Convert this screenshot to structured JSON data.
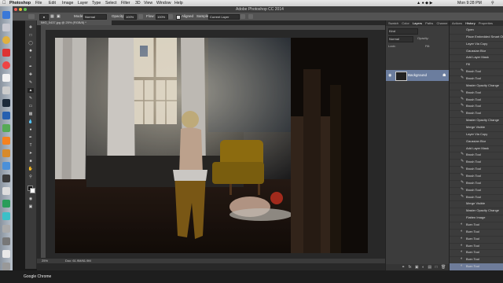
{
  "menubar": {
    "app": "Photoshop",
    "items": [
      "File",
      "Edit",
      "Image",
      "Layer",
      "Type",
      "Select",
      "Filter",
      "3D",
      "View",
      "Window",
      "Help"
    ],
    "clock": "Mon 9:28 PM"
  },
  "window": {
    "title": "Adobe Photoshop CC 2014"
  },
  "options": {
    "mode_label": "Mode:",
    "mode_value": "Normal",
    "opacity_label": "Opacity:",
    "opacity_value": "100%",
    "flow_label": "Flow:",
    "flow_value": "100%",
    "aligned": "Aligned",
    "sample_label": "Sample:",
    "sample_value": "Current Layer"
  },
  "document": {
    "tab": "IMG_0437.jpg @ 25% (RGB/8) *",
    "status_zoom": "25%",
    "status_doc": "Doc: 61.9M/61.9M"
  },
  "panels": {
    "tabs": [
      "Swatch",
      "Color",
      "Layers",
      "Paths",
      "Channe"
    ],
    "active_tab": "Layers",
    "kind_label": "Kind",
    "blend": "Normal",
    "opacity_label": "Opacity:",
    "lock_label": "Lock:",
    "fill_label": "Fill:",
    "layer_name": "Background"
  },
  "history": {
    "tabs": [
      "Actions",
      "History",
      "Properties"
    ],
    "active_tab": "History",
    "items": [
      {
        "icon": "none",
        "label": "Open"
      },
      {
        "icon": "none",
        "label": "Place Embedded Smart Object"
      },
      {
        "icon": "none",
        "label": "Layer Via Copy"
      },
      {
        "icon": "none",
        "label": "Gaussian Blur"
      },
      {
        "icon": "none",
        "label": "Add Layer Mask"
      },
      {
        "icon": "none",
        "label": "Fill"
      },
      {
        "icon": "brush",
        "label": "Brush Tool"
      },
      {
        "icon": "brush",
        "label": "Brush Tool"
      },
      {
        "icon": "none",
        "label": "Master Opacity Change"
      },
      {
        "icon": "brush",
        "label": "Brush Tool"
      },
      {
        "icon": "brush",
        "label": "Brush Tool"
      },
      {
        "icon": "brush",
        "label": "Brush Tool"
      },
      {
        "icon": "brush",
        "label": "Brush Tool"
      },
      {
        "icon": "none",
        "label": "Master Opacity Change"
      },
      {
        "icon": "none",
        "label": "Merge Visible"
      },
      {
        "icon": "none",
        "label": "Layer Via Copy"
      },
      {
        "icon": "none",
        "label": "Gaussian Blur"
      },
      {
        "icon": "none",
        "label": "Add Layer Mask"
      },
      {
        "icon": "brush",
        "label": "Brush Tool"
      },
      {
        "icon": "brush",
        "label": "Brush Tool"
      },
      {
        "icon": "brush",
        "label": "Brush Tool"
      },
      {
        "icon": "brush",
        "label": "Brush Tool"
      },
      {
        "icon": "brush",
        "label": "Brush Tool"
      },
      {
        "icon": "brush",
        "label": "Brush Tool"
      },
      {
        "icon": "brush",
        "label": "Brush Tool"
      },
      {
        "icon": "none",
        "label": "Merge Visible"
      },
      {
        "icon": "none",
        "label": "Master Opacity Change"
      },
      {
        "icon": "none",
        "label": "Flatten Image"
      },
      {
        "icon": "burn",
        "label": "Burn Tool"
      },
      {
        "icon": "burn",
        "label": "Burn Tool"
      },
      {
        "icon": "burn",
        "label": "Burn Tool"
      },
      {
        "icon": "burn",
        "label": "Burn Tool"
      },
      {
        "icon": "burn",
        "label": "Burn Tool"
      },
      {
        "icon": "burn",
        "label": "Burn Tool"
      },
      {
        "icon": "burn",
        "label": "Burn Tool"
      }
    ]
  },
  "dock_tooltip": "Google Chrome",
  "colors": {
    "selection": "#6e7c9a",
    "panel_bg": "#3c3c3c",
    "photo_dark": "#141414"
  }
}
